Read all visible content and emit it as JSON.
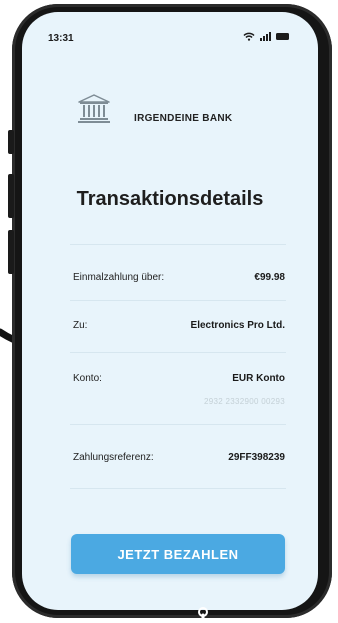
{
  "status_bar": {
    "time": "13:31"
  },
  "bank": {
    "name": "IRGENDEINE BANK",
    "logo_icon": "bank-building-icon"
  },
  "page": {
    "title": "Transaktionsdetails"
  },
  "details": [
    {
      "label": "Einmalzahlung über:",
      "value": "€99.98"
    },
    {
      "label": "Zu:",
      "value": "Electronics Pro Ltd."
    },
    {
      "label": "Konto:",
      "value": "EUR Konto",
      "sub_value": "2932 2332900 00293"
    },
    {
      "label": "Zahlungsreferenz:",
      "value": "29FF398239"
    }
  ],
  "actions": {
    "pay_label": "JETZT BEZAHLEN"
  },
  "colors": {
    "screen_background": "#e8f4fb",
    "accent_button": "#4ba9e2",
    "frame": "#151515"
  }
}
